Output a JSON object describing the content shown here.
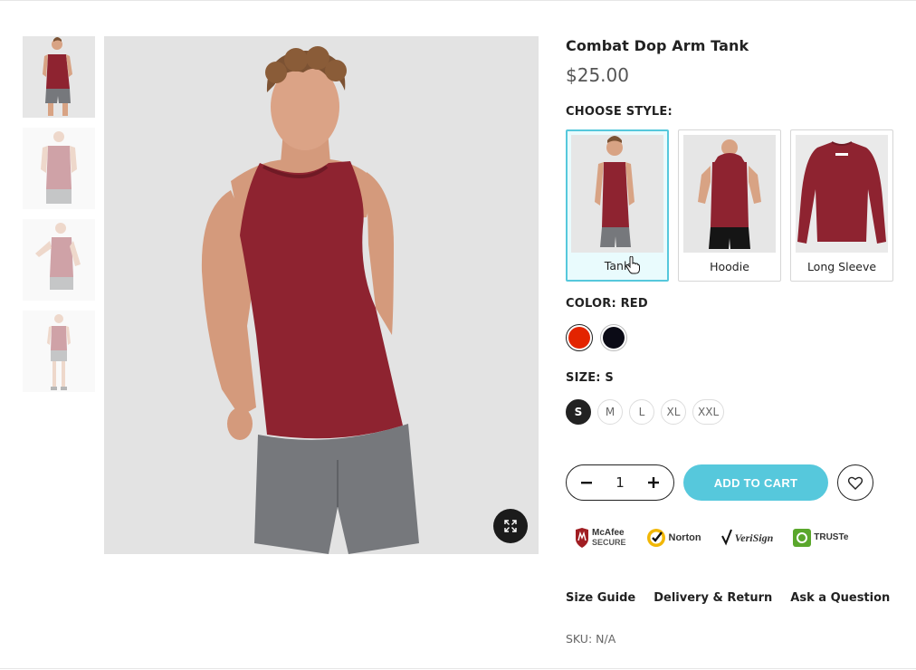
{
  "product": {
    "title": "Combat Dop Arm Tank",
    "price": "$25.00"
  },
  "thumbnails": [
    {
      "name": "front-view",
      "active": true
    },
    {
      "name": "back-view",
      "active": false
    },
    {
      "name": "side-view",
      "active": false
    },
    {
      "name": "full-body-view",
      "active": false
    }
  ],
  "style": {
    "label": "CHOOSE STYLE:",
    "options": [
      {
        "label": "Tank",
        "selected": true
      },
      {
        "label": "Hoodie",
        "selected": false
      },
      {
        "label": "Long Sleeve",
        "selected": false
      }
    ]
  },
  "color": {
    "label": "COLOR: RED",
    "options": [
      {
        "name": "red",
        "hex": "#e32400",
        "selected": true
      },
      {
        "name": "black",
        "hex": "#0b0b16",
        "selected": false
      }
    ]
  },
  "size": {
    "label": "SIZE: S",
    "options": [
      "S",
      "M",
      "L",
      "XL",
      "XXL"
    ],
    "selected": "S"
  },
  "cart": {
    "quantity": "1",
    "minus": "-",
    "plus": "+",
    "add_label": "ADD TO CART"
  },
  "trust_badges": [
    {
      "name": "mcafee",
      "line1": "McAfee",
      "line2": "SECURE"
    },
    {
      "name": "norton",
      "line1": "Norton",
      "line2": ""
    },
    {
      "name": "verisign",
      "line1": "VeriSign",
      "line2": ""
    },
    {
      "name": "truste",
      "line1": "TRUSTe",
      "line2": ""
    }
  ],
  "links": {
    "size_guide": "Size Guide",
    "delivery": "Delivery & Return",
    "question": "Ask a Question"
  },
  "sku": "SKU: N/A",
  "colors": {
    "accent": "#56c8dc",
    "tank_red": "#8e2330",
    "shorts_gray": "#76787c"
  }
}
